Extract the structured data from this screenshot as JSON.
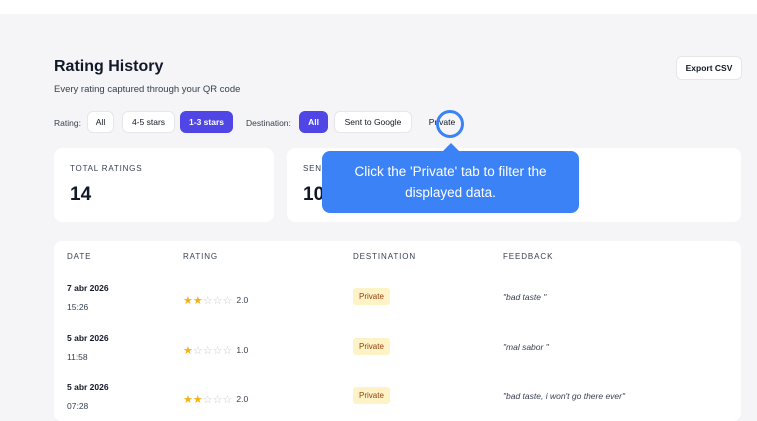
{
  "header": {
    "title": "Rating History",
    "subtitle": "Every rating captured through your QR code",
    "export_label": "Export CSV"
  },
  "filters": {
    "rating_label": "Rating:",
    "rating_options": [
      "All",
      "4-5 stars",
      "1-3 stars"
    ],
    "rating_selected": "1-3 stars",
    "destination_label": "Destination:",
    "destination_options": [
      "All",
      "Sent to Google",
      "Private"
    ],
    "destination_selected": "All"
  },
  "stats": [
    {
      "label": "TOTAL RATINGS",
      "value": "14"
    },
    {
      "label": "SENT",
      "value": "10"
    }
  ],
  "tooltip": {
    "text": "Click the 'Private' tab to filter the displayed data."
  },
  "table": {
    "columns": [
      "DATE",
      "RATING",
      "DESTINATION",
      "FEEDBACK"
    ],
    "rows": [
      {
        "date": "7 abr 2026",
        "time": "15:26",
        "stars": 2,
        "rating": "2.0",
        "destination": "Private",
        "feedback": "\"bad taste \""
      },
      {
        "date": "5 abr 2026",
        "time": "11:58",
        "stars": 1,
        "rating": "1.0",
        "destination": "Private",
        "feedback": "\"mal sabor \""
      },
      {
        "date": "5 abr 2026",
        "time": "07:28",
        "stars": 2,
        "rating": "2.0",
        "destination": "Private",
        "feedback": "\"bad taste, i won't go there ever\""
      }
    ]
  },
  "colors": {
    "accent": "#4f46e5",
    "tooltip": "#3b82f6",
    "star": "#f5b014",
    "badge_bg": "#fef3c7"
  }
}
